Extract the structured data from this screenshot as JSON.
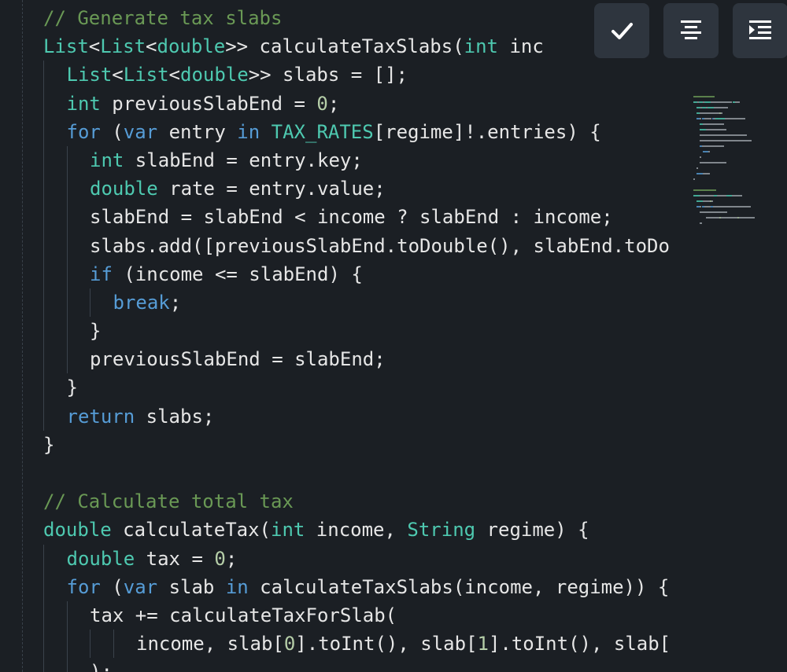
{
  "toolbar": {
    "buttons": [
      {
        "name": "check",
        "icon": "check-icon"
      },
      {
        "name": "align-center",
        "icon": "align-center-icon"
      },
      {
        "name": "indent",
        "icon": "indent-icon"
      }
    ]
  },
  "colors": {
    "background": "#1b1f24",
    "comment": "#6a9955",
    "type": "#4ec9b0",
    "keyword": "#569cd6",
    "number": "#b5cea8",
    "function": "#dcdcaa",
    "button_bg": "#2e353e"
  },
  "code": {
    "lines": [
      {
        "indent": 0,
        "tokens": [
          {
            "t": "// Generate tax slabs",
            "c": "c"
          }
        ]
      },
      {
        "indent": 0,
        "tokens": [
          {
            "t": "List",
            "c": "t"
          },
          {
            "t": "<",
            "c": "p"
          },
          {
            "t": "List",
            "c": "t"
          },
          {
            "t": "<",
            "c": "p"
          },
          {
            "t": "double",
            "c": "t"
          },
          {
            "t": ">> calculateTaxSlabs(",
            "c": "p"
          },
          {
            "t": "int",
            "c": "t"
          },
          {
            "t": " inc",
            "c": "p"
          }
        ]
      },
      {
        "indent": 1,
        "tokens": [
          {
            "t": "List",
            "c": "t"
          },
          {
            "t": "<",
            "c": "p"
          },
          {
            "t": "List",
            "c": "t"
          },
          {
            "t": "<",
            "c": "p"
          },
          {
            "t": "double",
            "c": "t"
          },
          {
            "t": ">> slabs = [];",
            "c": "p"
          }
        ]
      },
      {
        "indent": 1,
        "tokens": [
          {
            "t": "int",
            "c": "t"
          },
          {
            "t": " previousSlabEnd = ",
            "c": "p"
          },
          {
            "t": "0",
            "c": "n"
          },
          {
            "t": ";",
            "c": "p"
          }
        ]
      },
      {
        "indent": 1,
        "tokens": [
          {
            "t": "for",
            "c": "k"
          },
          {
            "t": " (",
            "c": "p"
          },
          {
            "t": "var",
            "c": "k"
          },
          {
            "t": " entry ",
            "c": "p"
          },
          {
            "t": "in",
            "c": "k"
          },
          {
            "t": " ",
            "c": "p"
          },
          {
            "t": "TAX_RATES",
            "c": "t"
          },
          {
            "t": "[regime]!.entries) {",
            "c": "p"
          }
        ]
      },
      {
        "indent": 2,
        "tokens": [
          {
            "t": "int",
            "c": "t"
          },
          {
            "t": " slabEnd = entry.key;",
            "c": "p"
          }
        ]
      },
      {
        "indent": 2,
        "tokens": [
          {
            "t": "double",
            "c": "t"
          },
          {
            "t": " rate = entry.value;",
            "c": "p"
          }
        ]
      },
      {
        "indent": 2,
        "tokens": [
          {
            "t": "slabEnd = slabEnd < income ? slabEnd : income;",
            "c": "p"
          }
        ]
      },
      {
        "indent": 2,
        "tokens": [
          {
            "t": "slabs.add([previousSlabEnd.toDouble(), slabEnd.toDo",
            "c": "p"
          }
        ]
      },
      {
        "indent": 2,
        "tokens": [
          {
            "t": "if",
            "c": "k"
          },
          {
            "t": " (income <= slabEnd) {",
            "c": "p"
          }
        ]
      },
      {
        "indent": 3,
        "tokens": [
          {
            "t": "break",
            "c": "k"
          },
          {
            "t": ";",
            "c": "p"
          }
        ]
      },
      {
        "indent": 2,
        "tokens": [
          {
            "t": "}",
            "c": "p"
          }
        ]
      },
      {
        "indent": 2,
        "tokens": [
          {
            "t": "previousSlabEnd = slabEnd;",
            "c": "p"
          }
        ]
      },
      {
        "indent": 1,
        "tokens": [
          {
            "t": "}",
            "c": "p"
          }
        ]
      },
      {
        "indent": 1,
        "tokens": [
          {
            "t": "return",
            "c": "k"
          },
          {
            "t": " slabs;",
            "c": "p"
          }
        ]
      },
      {
        "indent": 0,
        "tokens": [
          {
            "t": "}",
            "c": "p"
          }
        ]
      },
      {
        "indent": 0,
        "tokens": []
      },
      {
        "indent": 0,
        "tokens": [
          {
            "t": "// Calculate total tax",
            "c": "c"
          }
        ]
      },
      {
        "indent": 0,
        "tokens": [
          {
            "t": "double",
            "c": "t"
          },
          {
            "t": " calculateTax(",
            "c": "p"
          },
          {
            "t": "int",
            "c": "t"
          },
          {
            "t": " income, ",
            "c": "p"
          },
          {
            "t": "String",
            "c": "t"
          },
          {
            "t": " regime) {",
            "c": "p"
          }
        ]
      },
      {
        "indent": 1,
        "tokens": [
          {
            "t": "double",
            "c": "t"
          },
          {
            "t": " tax = ",
            "c": "p"
          },
          {
            "t": "0",
            "c": "n"
          },
          {
            "t": ";",
            "c": "p"
          }
        ]
      },
      {
        "indent": 1,
        "tokens": [
          {
            "t": "for",
            "c": "k"
          },
          {
            "t": " (",
            "c": "p"
          },
          {
            "t": "var",
            "c": "k"
          },
          {
            "t": " slab ",
            "c": "p"
          },
          {
            "t": "in",
            "c": "k"
          },
          {
            "t": " calculateTaxSlabs(income, regime)) {",
            "c": "p"
          }
        ]
      },
      {
        "indent": 2,
        "tokens": [
          {
            "t": "tax += calculateTaxForSlab(",
            "c": "p"
          }
        ]
      },
      {
        "indent": 4,
        "tokens": [
          {
            "t": "income, slab[",
            "c": "p"
          },
          {
            "t": "0",
            "c": "n"
          },
          {
            "t": "].toInt(), slab[",
            "c": "p"
          },
          {
            "t": "1",
            "c": "n"
          },
          {
            "t": "].toInt(), slab[",
            "c": "p"
          }
        ]
      },
      {
        "indent": 2,
        "tokens": [
          {
            "t": ");",
            "c": "p"
          }
        ]
      }
    ]
  }
}
